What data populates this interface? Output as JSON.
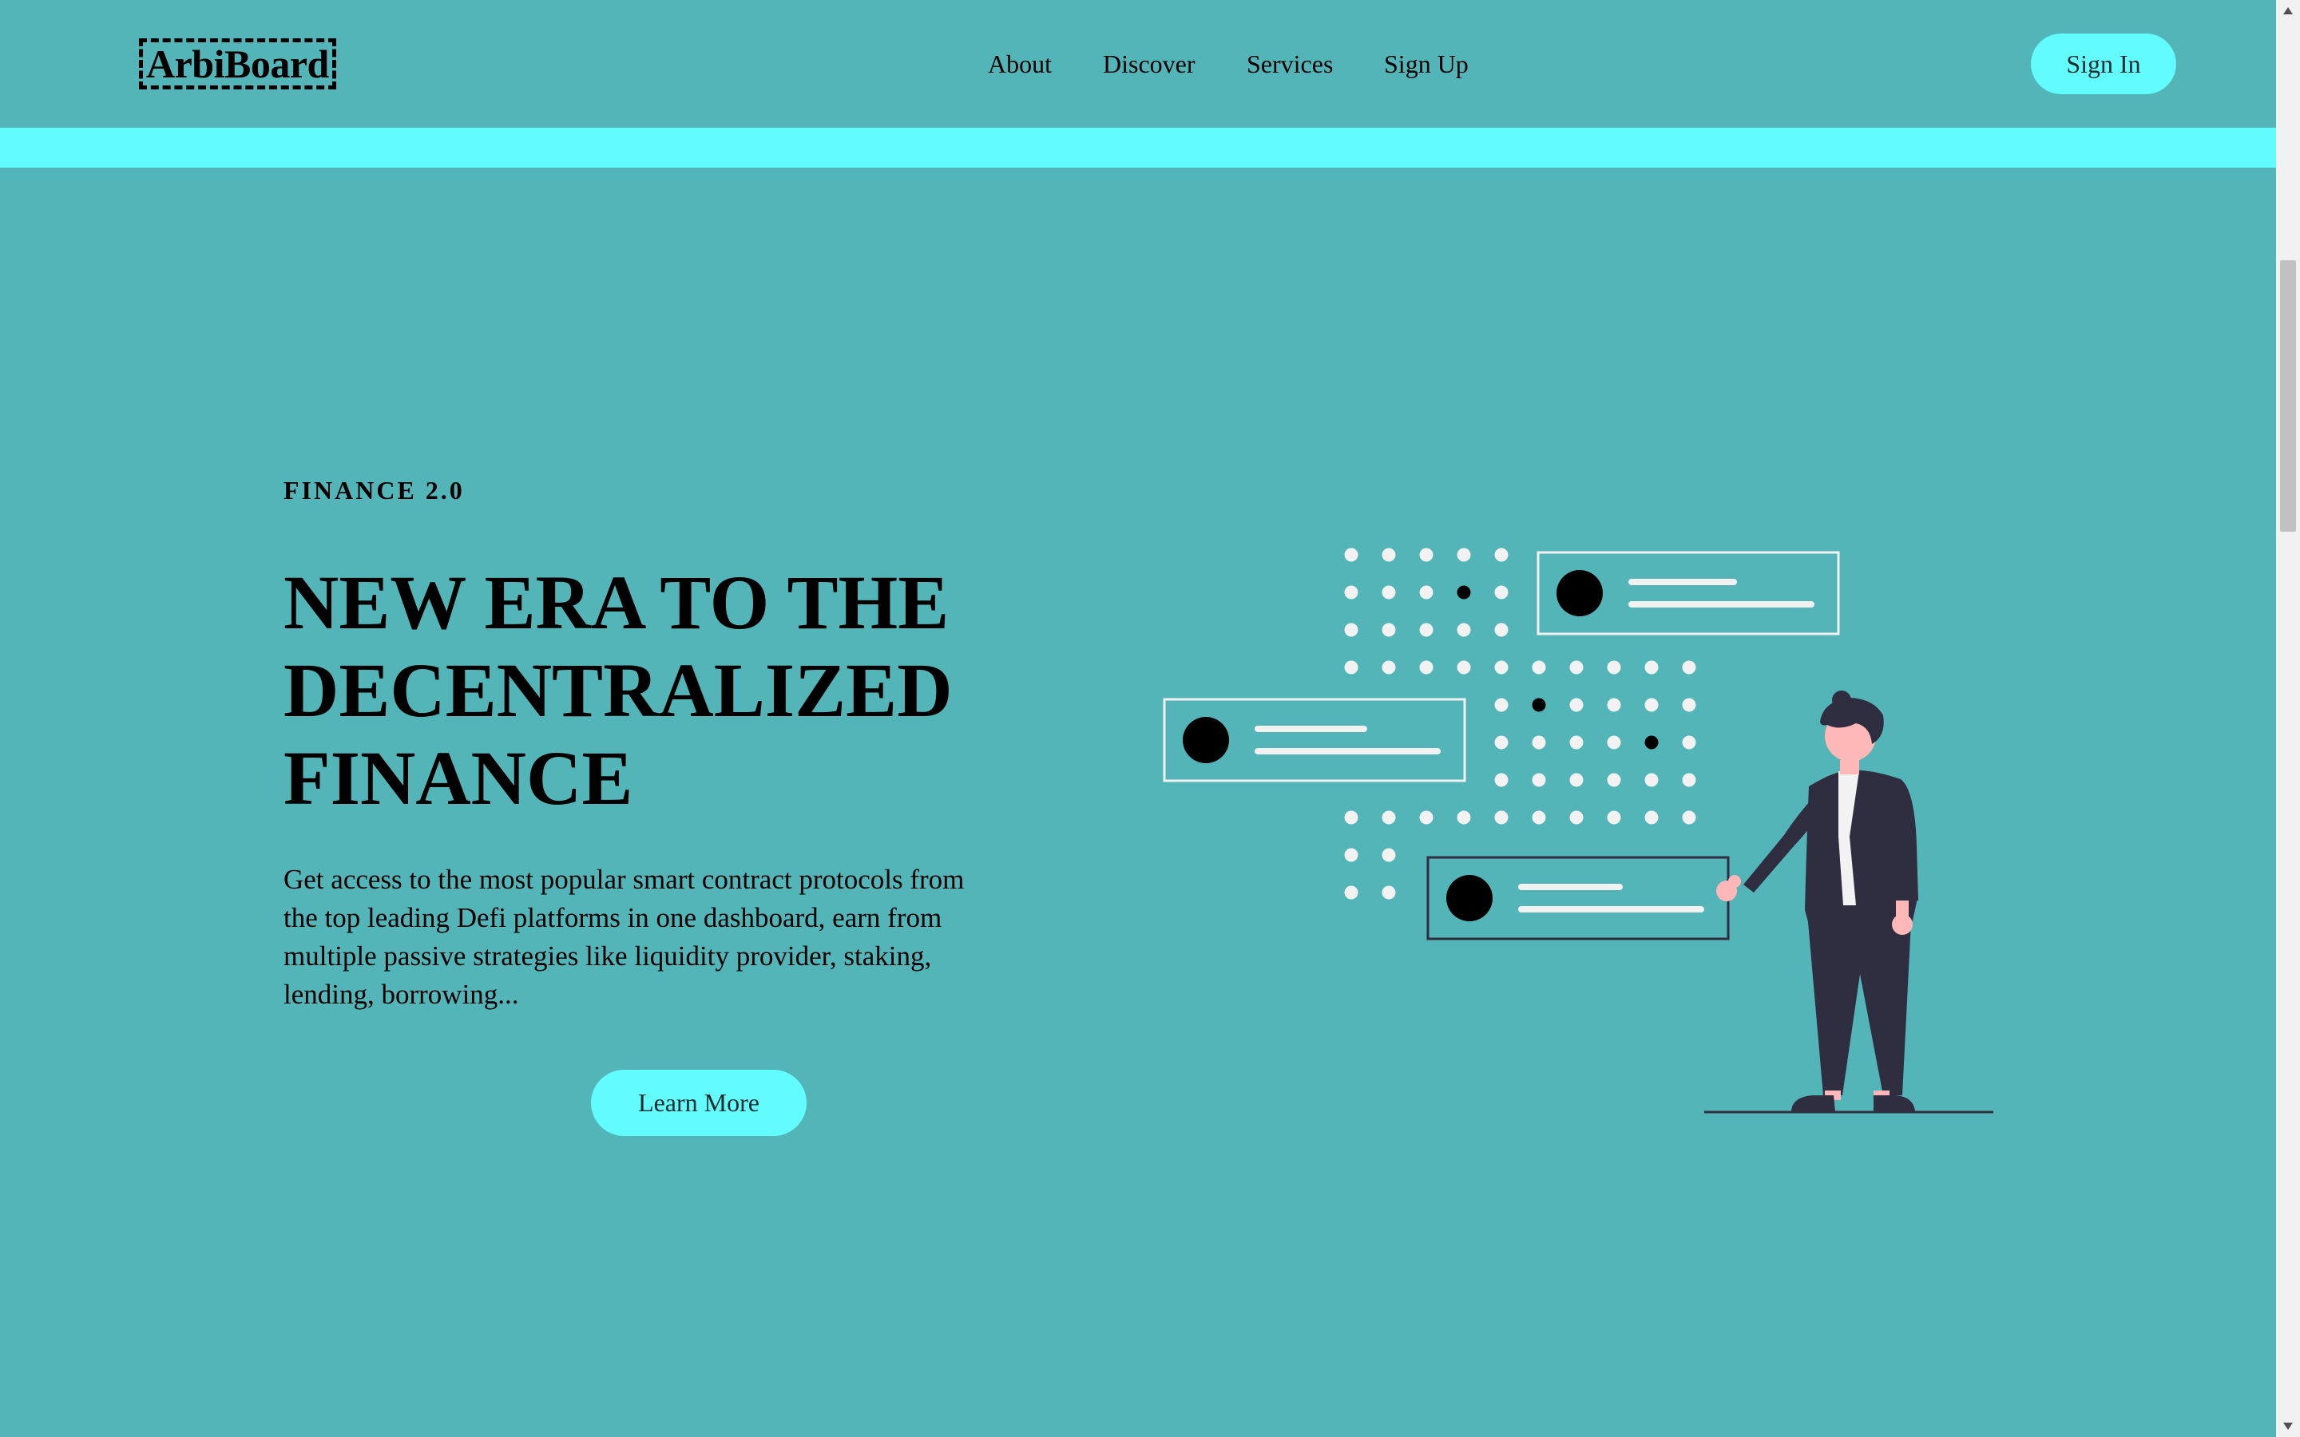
{
  "header": {
    "logo": "ArbiBoard",
    "nav": [
      "About",
      "Discover",
      "Services",
      "Sign Up"
    ],
    "sign_in": "Sign In"
  },
  "hero": {
    "eyebrow": "FINANCE 2.0",
    "headline": [
      "NEW ERA TO THE",
      "DECENTRALIZED",
      "FINANCE"
    ],
    "description": "Get access to the most popular smart contract protocols from the top leading Defi platforms in one dashboard, earn from multiple passive strategies like liquidity provider, staking, lending, borrowing...",
    "cta": "Learn More"
  },
  "colors": {
    "background": "#54b5b8",
    "accent": "#62fcfe",
    "text": "#000000",
    "illustration_dark": "#2f2e41",
    "illustration_skin": "#ffb8b8",
    "illustration_light": "#f2f2f2"
  },
  "icons": [
    "person-illustration",
    "dot-grid",
    "profile-card"
  ]
}
